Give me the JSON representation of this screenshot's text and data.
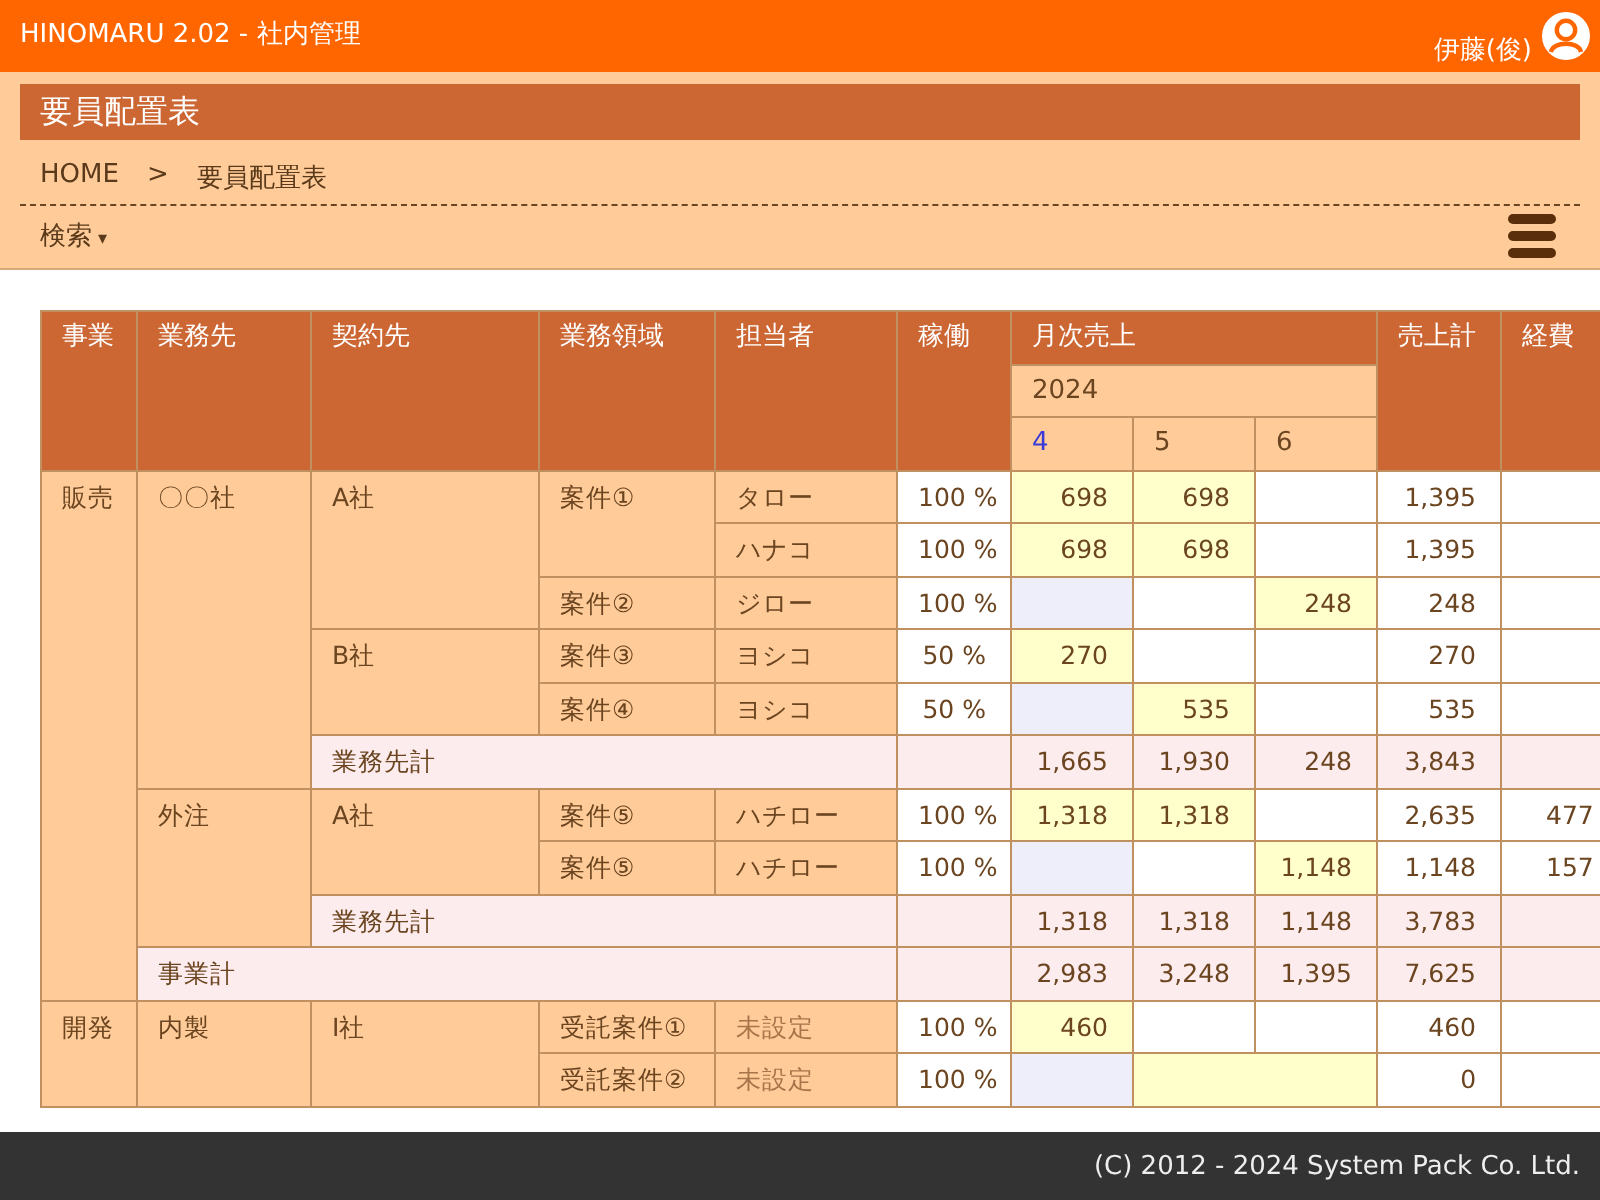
{
  "app_bar": {
    "title": "HINOMARU 2.02 - 社内管理",
    "user": "伊藤(俊)"
  },
  "page_title": "要員配置表",
  "breadcrumb": {
    "items": [
      "HOME",
      "要員配置表"
    ],
    "separator": ">"
  },
  "search_toggle": {
    "label": "検索",
    "arrow": "▾"
  },
  "table": {
    "header_rows": [
      [
        {
          "text": "事業",
          "kind": "head",
          "rowspan": 3
        },
        {
          "text": "業務先",
          "kind": "head",
          "rowspan": 3
        },
        {
          "text": "契約先",
          "kind": "head",
          "rowspan": 3
        },
        {
          "text": "業務領域",
          "kind": "head",
          "rowspan": 3
        },
        {
          "text": "担当者",
          "kind": "head",
          "rowspan": 3
        },
        {
          "text": "稼働",
          "kind": "head",
          "rowspan": 3
        },
        {
          "text": "月次売上",
          "kind": "head",
          "colspan": 3
        },
        {
          "text": "売上計",
          "kind": "head",
          "rowspan": 3
        },
        {
          "text": "経費",
          "kind": "head",
          "rowspan": 3
        }
      ],
      [
        {
          "text": "2024",
          "kind": "year",
          "colspan": 3
        }
      ],
      [
        {
          "text": "4",
          "kind": "month",
          "selected": true
        },
        {
          "text": "5",
          "kind": "month",
          "selected": false
        },
        {
          "text": "6",
          "kind": "month",
          "selected": false
        }
      ]
    ],
    "rows": [
      [
        {
          "text": "販売",
          "kind": "group",
          "rowspan": 10
        },
        {
          "text": "〇〇社",
          "kind": "group",
          "rowspan": 6
        },
        {
          "text": "A社",
          "kind": "group",
          "rowspan": 3
        },
        {
          "text": "案件①",
          "kind": "group",
          "rowspan": 2
        },
        {
          "text": "タロー",
          "kind": "group"
        },
        {
          "text": "100 %",
          "kind": "rate"
        },
        {
          "text": "698",
          "kind": "plan"
        },
        {
          "text": "698",
          "kind": "plan"
        },
        {
          "kind": "blank"
        },
        {
          "text": "1,395",
          "kind": "total"
        },
        {
          "kind": "blank"
        }
      ],
      [
        {
          "text": "ハナコ",
          "kind": "group"
        },
        {
          "text": "100 %",
          "kind": "rate"
        },
        {
          "text": "698",
          "kind": "plan"
        },
        {
          "text": "698",
          "kind": "plan"
        },
        {
          "kind": "blank"
        },
        {
          "text": "1,395",
          "kind": "total"
        },
        {
          "kind": "blank"
        }
      ],
      [
        {
          "text": "案件②",
          "kind": "group"
        },
        {
          "text": "ジロー",
          "kind": "group"
        },
        {
          "text": "100 %",
          "kind": "rate"
        },
        {
          "kind": "gap"
        },
        {
          "kind": "blank"
        },
        {
          "text": "248",
          "kind": "plan"
        },
        {
          "text": "248",
          "kind": "total"
        },
        {
          "kind": "blank"
        }
      ],
      [
        {
          "text": "B社",
          "kind": "group",
          "rowspan": 2
        },
        {
          "text": "案件③",
          "kind": "group"
        },
        {
          "text": "ヨシコ",
          "kind": "group"
        },
        {
          "text": "50 %",
          "kind": "rate"
        },
        {
          "text": "270",
          "kind": "plan"
        },
        {
          "kind": "blank"
        },
        {
          "kind": "blank"
        },
        {
          "text": "270",
          "kind": "total"
        },
        {
          "kind": "blank"
        }
      ],
      [
        {
          "text": "案件④",
          "kind": "group"
        },
        {
          "text": "ヨシコ",
          "kind": "group"
        },
        {
          "text": "50 %",
          "kind": "rate"
        },
        {
          "kind": "gap"
        },
        {
          "text": "535",
          "kind": "plan"
        },
        {
          "kind": "blank"
        },
        {
          "text": "535",
          "kind": "total"
        },
        {
          "kind": "blank"
        }
      ],
      [
        {
          "text": "業務先計",
          "kind": "sumlabel",
          "colspan": 3
        },
        {
          "kind": "sum"
        },
        {
          "text": "1,665",
          "kind": "sum"
        },
        {
          "text": "1,930",
          "kind": "sum"
        },
        {
          "text": "248",
          "kind": "sum"
        },
        {
          "text": "3,843",
          "kind": "sum"
        },
        {
          "kind": "sum"
        }
      ],
      [
        {
          "text": "外注",
          "kind": "group",
          "rowspan": 3
        },
        {
          "text": "A社",
          "kind": "group",
          "rowspan": 2
        },
        {
          "text": "案件⑤",
          "kind": "group"
        },
        {
          "text": "ハチロー",
          "kind": "group"
        },
        {
          "text": "100 %",
          "kind": "rate"
        },
        {
          "text": "1,318",
          "kind": "plan"
        },
        {
          "text": "1,318",
          "kind": "plan"
        },
        {
          "kind": "blank"
        },
        {
          "text": "2,635",
          "kind": "total"
        },
        {
          "text": "477",
          "kind": "total"
        }
      ],
      [
        {
          "text": "案件⑤",
          "kind": "group"
        },
        {
          "text": "ハチロー",
          "kind": "group"
        },
        {
          "text": "100 %",
          "kind": "rate"
        },
        {
          "kind": "gap"
        },
        {
          "kind": "blank"
        },
        {
          "text": "1,148",
          "kind": "plan"
        },
        {
          "text": "1,148",
          "kind": "total"
        },
        {
          "text": "157",
          "kind": "total"
        }
      ],
      [
        {
          "text": "業務先計",
          "kind": "sumlabel",
          "colspan": 3
        },
        {
          "kind": "sum"
        },
        {
          "text": "1,318",
          "kind": "sum"
        },
        {
          "text": "1,318",
          "kind": "sum"
        },
        {
          "text": "1,148",
          "kind": "sum"
        },
        {
          "text": "3,783",
          "kind": "sum"
        },
        {
          "kind": "sum"
        }
      ],
      [
        {
          "text": "事業計",
          "kind": "sumlabel",
          "colspan": 4
        },
        {
          "kind": "sum"
        },
        {
          "text": "2,983",
          "kind": "sum"
        },
        {
          "text": "3,248",
          "kind": "sum"
        },
        {
          "text": "1,395",
          "kind": "sum"
        },
        {
          "text": "7,625",
          "kind": "sum"
        },
        {
          "kind": "sum"
        }
      ],
      [
        {
          "text": "開発",
          "kind": "group",
          "rowspan": 2
        },
        {
          "text": "内製",
          "kind": "group",
          "rowspan": 2
        },
        {
          "text": "I社",
          "kind": "group",
          "rowspan": 2
        },
        {
          "text": "受託案件①",
          "kind": "group"
        },
        {
          "text": "未設定",
          "kind": "muted"
        },
        {
          "text": "100 %",
          "kind": "rate"
        },
        {
          "text": "460",
          "kind": "plan"
        },
        {
          "kind": "blank"
        },
        {
          "kind": "blank"
        },
        {
          "text": "460",
          "kind": "total"
        },
        {
          "kind": "blank"
        }
      ],
      [
        {
          "text": "受託案件②",
          "kind": "group"
        },
        {
          "text": "未設定",
          "kind": "muted"
        },
        {
          "text": "100 %",
          "kind": "rate"
        },
        {
          "kind": "gap"
        },
        {
          "kind": "plan",
          "colspan": 2
        },
        {
          "text": "0",
          "kind": "total"
        },
        {
          "kind": "blank"
        }
      ]
    ]
  },
  "footer": "(C) 2012 - 2024 System Pack Co. Ltd."
}
